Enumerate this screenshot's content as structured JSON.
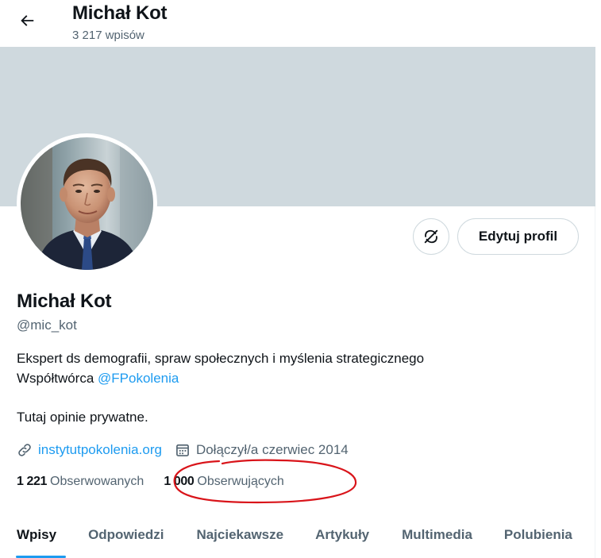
{
  "header": {
    "back_label": "Wstecz",
    "name": "Michał Kot",
    "post_count": "3 217 wpisów"
  },
  "profile": {
    "display_name": "Michał Kot",
    "handle": "@mic_kot",
    "bio_line1": "Ekspert ds demografii, spraw społecznych i myślenia strategicznego",
    "bio_line2_prefix": "Współtwórca ",
    "bio_mention": "@FPokolenia",
    "bio_line3": "Tutaj opinie prywatne.",
    "website": "instytutpokolenia.org",
    "joined": "Dołączył/a czerwiec 2014",
    "following_count": "1 221",
    "following_label": "Obserwowanych",
    "followers_count": "1 000",
    "followers_label": "Obserwujących"
  },
  "actions": {
    "edit_profile": "Edytuj profil"
  },
  "tabs": [
    {
      "label": "Wpisy",
      "active": true
    },
    {
      "label": "Odpowiedzi",
      "active": false
    },
    {
      "label": "Najciekawsze",
      "active": false
    },
    {
      "label": "Artykuły",
      "active": false
    },
    {
      "label": "Multimedia",
      "active": false
    },
    {
      "label": "Polubienia",
      "active": false
    }
  ],
  "colors": {
    "accent": "#1d9bf0",
    "banner": "#cfd9de",
    "annotation": "#d9141a",
    "muted_text": "#536471"
  },
  "icons": [
    "back-arrow-icon",
    "sync-icon",
    "link-icon",
    "calendar-icon"
  ]
}
